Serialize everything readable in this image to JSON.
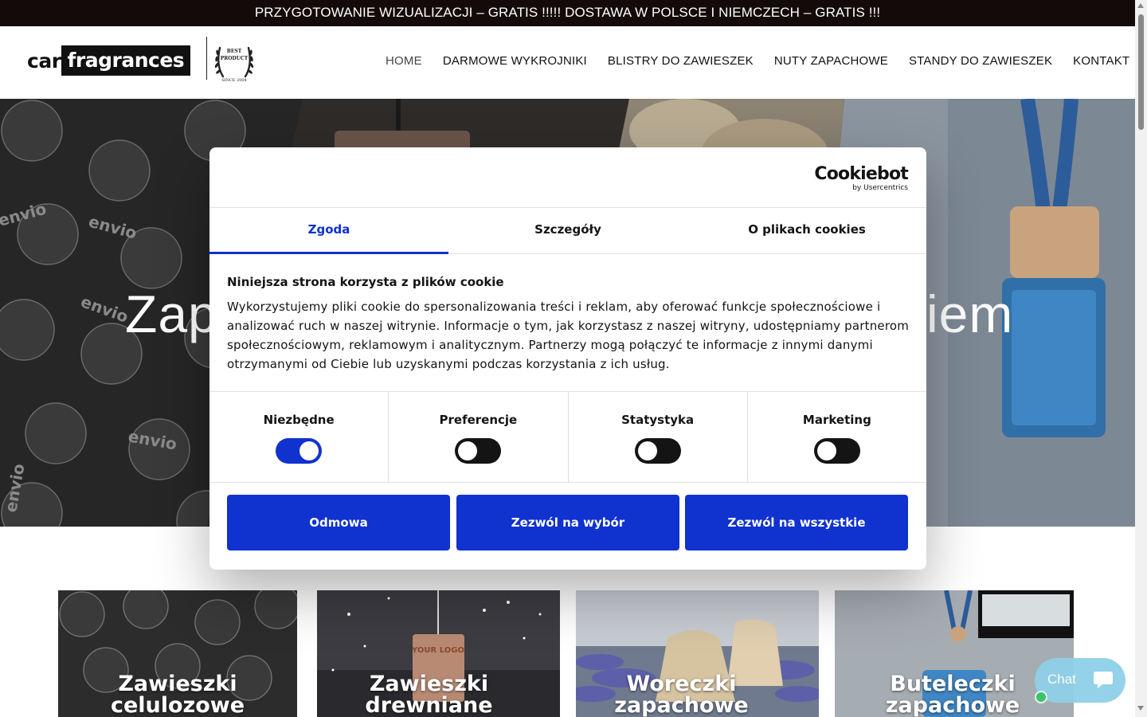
{
  "topbar": {
    "text": "PRZYGOTOWANIE WIZUALIZACJI – GRATIS !!!!! DOSTAWA W POLSCE I NIEMCZECH – GRATIS !!!"
  },
  "logo": {
    "car": "car",
    "fragrances": "fragrances",
    "badge_line1": "BEST",
    "badge_line2": "PRODUCT",
    "badge_since": "SINCE 2004"
  },
  "nav": {
    "items": [
      "HOME",
      "DARMOWE WYKROJNIKI",
      "BLISTRY DO ZAWIESZEK",
      "NUTY ZAPACHOWE",
      "STANDY DO ZAWIESZEK",
      "KONTAKT"
    ],
    "active": "HOME"
  },
  "hero": {
    "text_left": "Zap",
    "text_right": "iem",
    "package_brand": "envio"
  },
  "cookie": {
    "brand": "Cookiebot",
    "brand_sub": "by Usercentrics",
    "tabs": [
      "Zgoda",
      "Szczegóły",
      "O plikach cookies"
    ],
    "active_tab": "Zgoda",
    "title": "Niniejsza strona korzysta z plików cookie",
    "text": "Wykorzystujemy pliki cookie do spersonalizowania treści i reklam, aby oferować funkcje społecznościowe i analizować ruch w naszej witrynie. Informacje o tym, jak korzystasz z naszej witryny, udostępniamy partnerom społecznościowym, reklamowym i analitycznym. Partnerzy mogą połączyć te informacje z innymi danymi otrzymanymi od Ciebie lub uzyskanymi podczas korzystania z ich usług.",
    "toggles": [
      {
        "label": "Niezbędne",
        "on": true
      },
      {
        "label": "Preferencje",
        "on": false
      },
      {
        "label": "Statystyka",
        "on": false
      },
      {
        "label": "Marketing",
        "on": false
      }
    ],
    "buttons": [
      "Odmowa",
      "Zezwól na wybór",
      "Zezwól na wszystkie"
    ],
    "accent_color": "#1032cf"
  },
  "cards": [
    {
      "title": "Zawieszki celulozowe"
    },
    {
      "title": "Zawieszki drewniane",
      "sign_text": "YOUR LOGO"
    },
    {
      "title": "Woreczki zapachowe"
    },
    {
      "title": "Buteleczki zapachowe"
    }
  ],
  "chat": {
    "label": "Chat",
    "icon": "chat-bubble-icon",
    "status_color": "#39c26a"
  }
}
